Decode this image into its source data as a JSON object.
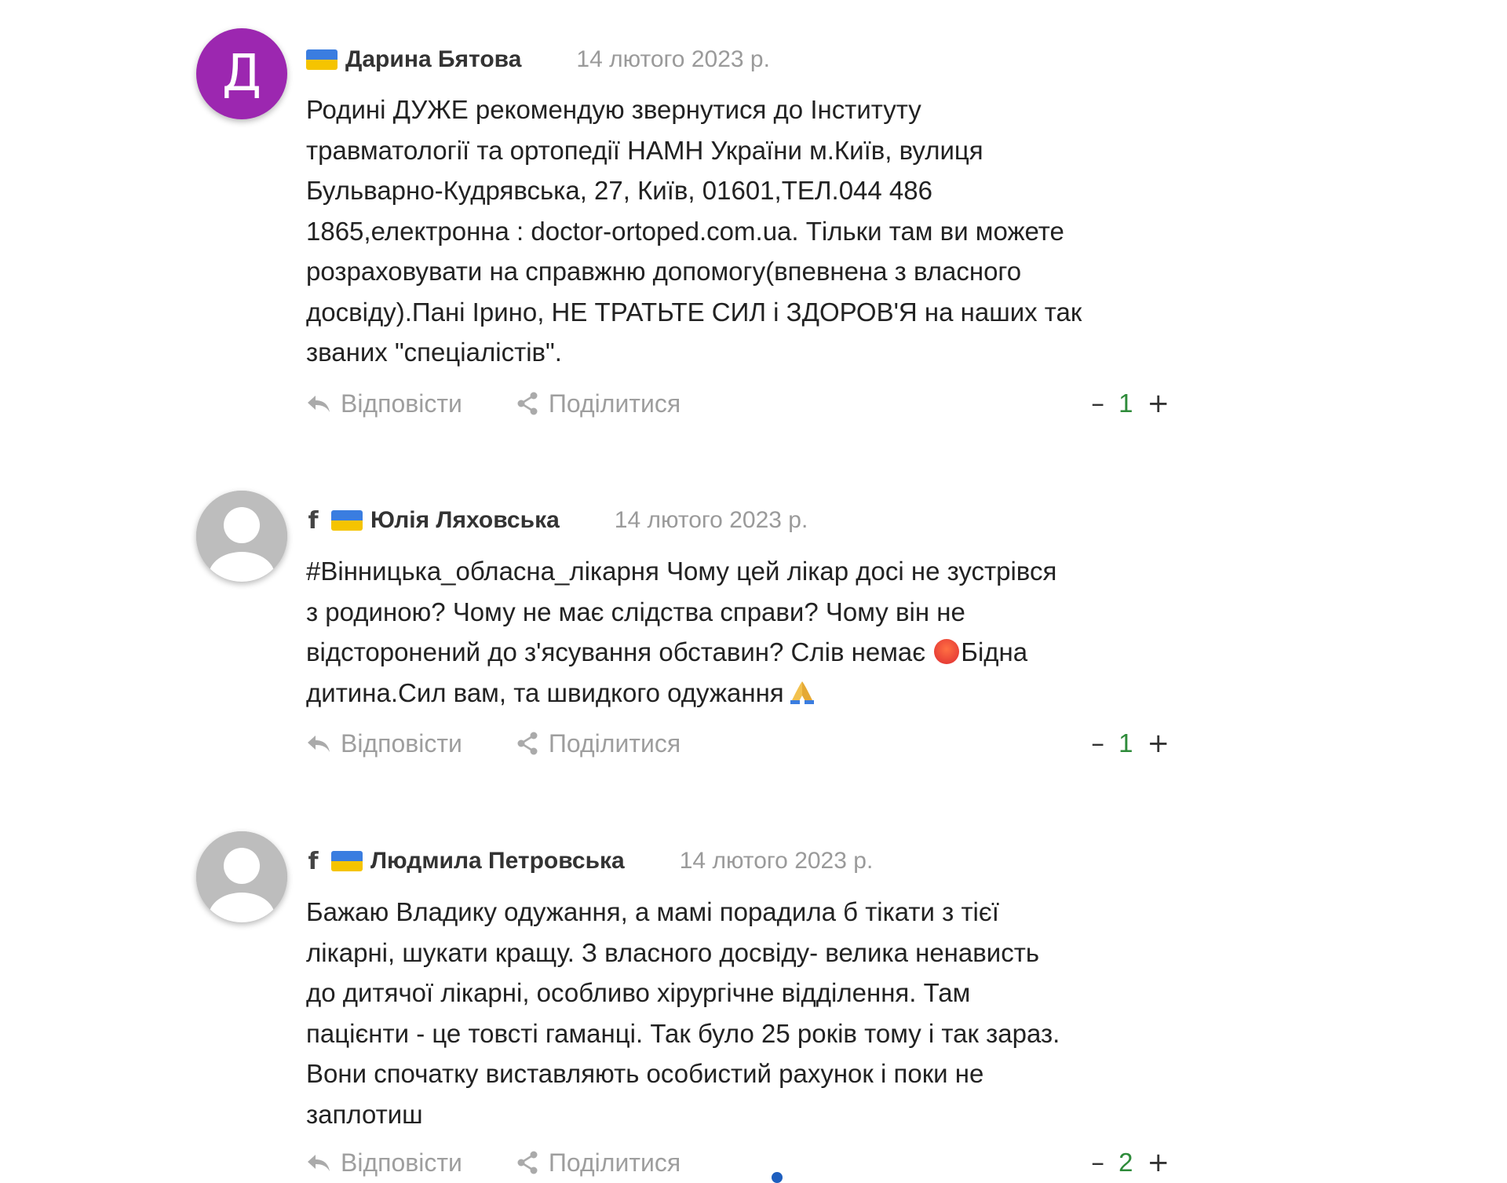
{
  "colors": {
    "avatar_purple": "#9c27b0",
    "score_green": "#2e8b3a",
    "flag_blue": "#3a7de0",
    "flag_yellow": "#f5c400"
  },
  "comments": [
    {
      "avatar_letter": "Д",
      "has_facebook": false,
      "author": "Дарина Бятова",
      "date": "14 лютого 2023 р.",
      "text": "Родині ДУЖЕ рекомендую звернутися до Інституту\nтравматології та ортопедії НАМН України м.Київ, вулиця\nБульварно-Кудрявська, 27, Київ, 01601,ТЕЛ.044 486\n1865,електронна : doctor-ortoped.com.ua. Тільки там ви можете\nрозраховувати на  справжню допомогу(впевнена з власного\nдосвіду).Пані Ірино, НЕ ТРАТЬТЕ СИЛ і ЗДОРОВ'Я на  наших так\nзваних \"спеціалістів\".",
      "reply_label": "Відповісти",
      "share_label": "Поділитися",
      "score": "1",
      "minus": "–",
      "plus": "+"
    },
    {
      "facebook_icon": "f",
      "has_facebook": true,
      "author": "Юлія Ляховська",
      "date": "14 лютого 2023 р.",
      "text_part1": "#Вінницька_обласна_лікарня Чому цей лікар досі не зустрівся\nз родиною? Чому не має слідства справи? Чому він не\nвідсторонений до з'ясування обставин?  Слів немає ",
      "text_part2": "Бідна\nдитина.Сил вам, та швидкого одужання",
      "reply_label": "Відповісти",
      "share_label": "Поділитися",
      "score": "1",
      "minus": "–",
      "plus": "+"
    },
    {
      "facebook_icon": "f",
      "has_facebook": true,
      "author": "Людмила Петровська",
      "date": "14 лютого 2023 р.",
      "text": "Бажаю Владику одужання, а мамі порадила б тікати з тієї\nлікарні, шукати кращу. З власного досвіду- велика ненависть\nдо дитячої лікарні, особливо хірургічне відділення. Там\nпацієнти - це товсті гаманці. Так було 25 років тому і так зараз.\nВони спочатку виставляють особистий рахунок і поки не\nзаплотиш",
      "reply_label": "Відповісти",
      "share_label": "Поділитися",
      "score": "2",
      "minus": "–",
      "plus": "+"
    }
  ]
}
